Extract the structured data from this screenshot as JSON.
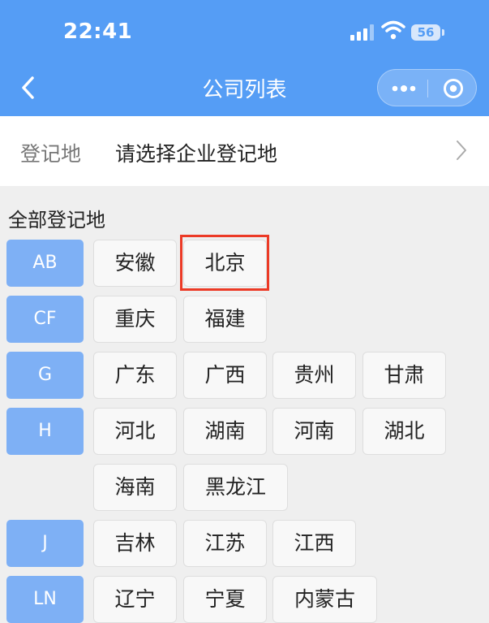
{
  "status_bar": {
    "time": "22:41",
    "battery": "56"
  },
  "nav": {
    "title": "公司列表"
  },
  "registration": {
    "label": "登记地",
    "placeholder": "请选择企业登记地"
  },
  "section": {
    "title": "全部登记地"
  },
  "letters": [
    "AB",
    "CF",
    "G",
    "H",
    "J",
    "LN"
  ],
  "provinces": {
    "ab": [
      "安徽",
      "北京"
    ],
    "cf": [
      "重庆",
      "福建"
    ],
    "g": [
      "广东",
      "广西",
      "贵州",
      "甘肃"
    ],
    "h1": [
      "河北",
      "湖南",
      "河南",
      "湖北"
    ],
    "h2": [
      "海南",
      "黑龙江"
    ],
    "j": [
      "吉林",
      "江苏",
      "江西"
    ],
    "ln": [
      "辽宁",
      "宁夏",
      "内蒙古"
    ]
  },
  "icons": {
    "back": "chevron-left-icon",
    "more": "more-dots-icon",
    "close": "mini-program-close-icon",
    "chevron": "chevron-right-icon"
  },
  "colors": {
    "header": "#559df5",
    "letter_tag": "#7eb0f5",
    "highlight": "#ec3a26"
  }
}
